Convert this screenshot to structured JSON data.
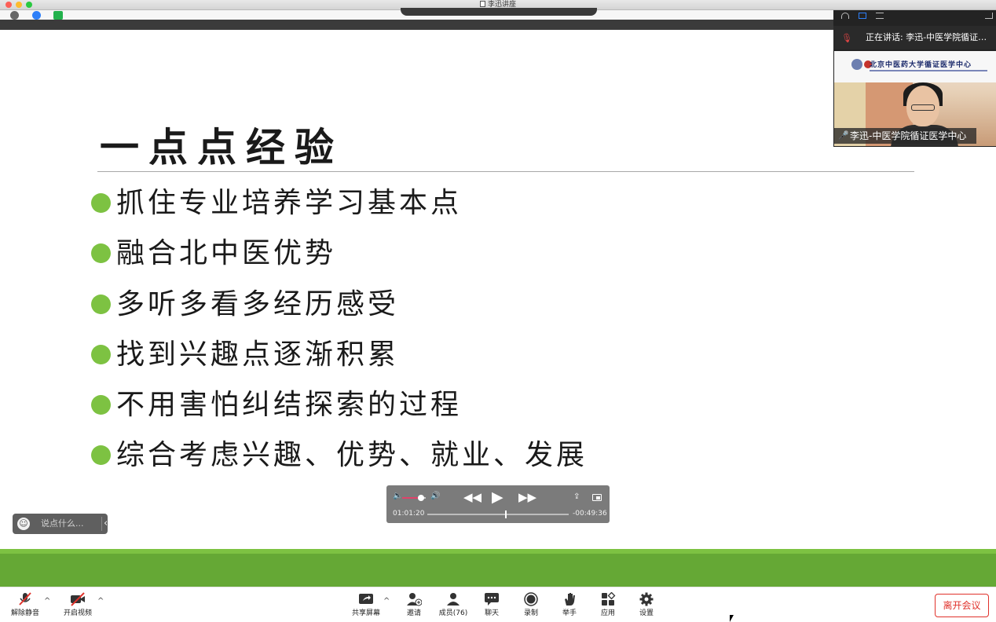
{
  "window": {
    "title": "李迅讲座"
  },
  "slide": {
    "title": "一点点经验",
    "bullets": [
      "抓住专业培养学习基本点",
      "融合北中医优势",
      "多听多看多经历感受",
      "找到兴趣点逐渐积累",
      "不用害怕纠结探索的过程",
      "综合考虑兴趣、优势、就业、发展"
    ],
    "bullet_color": "#7dc242"
  },
  "chat": {
    "placeholder": "说点什么..."
  },
  "player": {
    "elapsed": "01:01:20",
    "remaining": "-00:49:36",
    "progress": 0.553,
    "volume": 0.8,
    "accent": "#e0426a"
  },
  "video_panel": {
    "speaking_label": "正在讲话: 李迅-中医学院循证医...",
    "participant_name": "李迅-中医学院循证医学中心",
    "banner_text": "北京中医药大学循证医学中心"
  },
  "toolbar": {
    "unmute": "解除静音",
    "start_video": "开启视频",
    "share_screen": "共享屏幕",
    "invite": "邀请",
    "participants": "成员(76)",
    "chat": "聊天",
    "record": "录制",
    "raise_hand": "举手",
    "apps": "应用",
    "settings": "设置",
    "leave": "离开会议",
    "leave_color": "#e0322b"
  }
}
